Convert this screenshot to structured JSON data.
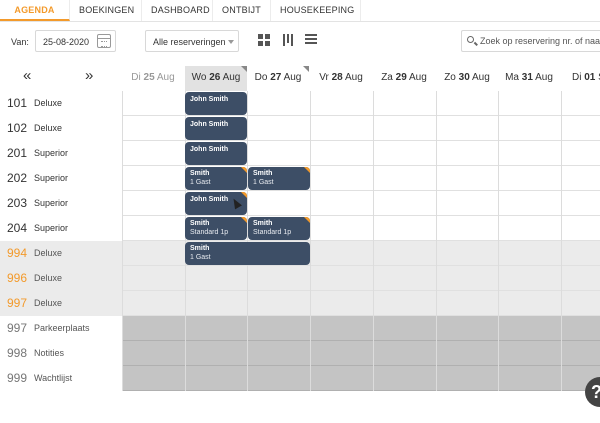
{
  "tabs": [
    {
      "label": "AGENDA",
      "active": true
    },
    {
      "label": "BOEKINGEN",
      "active": false
    },
    {
      "label": "DASHBOARD",
      "active": false
    },
    {
      "label": "ONTBIJT",
      "active": false
    },
    {
      "label": "HOUSEKEEPING",
      "active": false
    }
  ],
  "toolbar": {
    "van_label": "Van:",
    "date_value": "25-08-2020",
    "filter_value": "Alle reserveringen",
    "search_placeholder": "Zoek op reservering nr. of naam"
  },
  "nav": {
    "prev": "«",
    "next": "»"
  },
  "days": [
    {
      "dow": "Di",
      "day": "25",
      "month": "Aug",
      "state": "past"
    },
    {
      "dow": "Wo",
      "day": "26",
      "month": "Aug",
      "state": "today"
    },
    {
      "dow": "Do",
      "day": "27",
      "month": "Aug",
      "state": "normal"
    },
    {
      "dow": "Vr",
      "day": "28",
      "month": "Aug",
      "state": "normal"
    },
    {
      "dow": "Za",
      "day": "29",
      "month": "Aug",
      "state": "weekend"
    },
    {
      "dow": "Zo",
      "day": "30",
      "month": "Aug",
      "state": "weekend"
    },
    {
      "dow": "Ma",
      "day": "31",
      "month": "Aug",
      "state": "normal"
    },
    {
      "dow": "Di",
      "day": "01",
      "month": "S",
      "state": "normal"
    }
  ],
  "rooms": [
    {
      "number": "101",
      "type": "Deluxe",
      "kind": "room"
    },
    {
      "number": "102",
      "type": "Deluxe",
      "kind": "room"
    },
    {
      "number": "201",
      "type": "Superior",
      "kind": "room"
    },
    {
      "number": "202",
      "type": "Superior",
      "kind": "room"
    },
    {
      "number": "203",
      "type": "Superior",
      "kind": "room"
    },
    {
      "number": "204",
      "type": "Superior",
      "kind": "room"
    },
    {
      "number": "994",
      "type": "Deluxe",
      "kind": "virtual"
    },
    {
      "number": "996",
      "type": "Deluxe",
      "kind": "virtual"
    },
    {
      "number": "997",
      "type": "Deluxe",
      "kind": "virtual"
    },
    {
      "number": "997",
      "type": "Parkeerplaats",
      "kind": "extra"
    },
    {
      "number": "998",
      "type": "Notities",
      "kind": "extra"
    },
    {
      "number": "999",
      "type": "Wachtlijst",
      "kind": "extra"
    }
  ],
  "bookings": [
    {
      "name": "John Smith",
      "sub": "",
      "flag": false
    },
    {
      "name": "John Smith",
      "sub": "",
      "flag": false
    },
    {
      "name": "John Smith",
      "sub": "",
      "flag": false
    },
    {
      "name": "Smith",
      "sub": "1 Gast",
      "flag": true
    },
    {
      "name": "Smith",
      "sub": "1 Gast",
      "flag": true
    },
    {
      "name": "John Smith",
      "sub": "",
      "flag": true
    },
    {
      "name": "Smith",
      "sub": "Standard 1p",
      "flag": true
    },
    {
      "name": "Smith",
      "sub": "Standard 1p",
      "flag": true
    },
    {
      "name": "Smith",
      "sub": "1 Gast",
      "flag": false
    }
  ],
  "help": {
    "label": "?"
  },
  "colors": {
    "accent": "#f39a2b",
    "booking": "#3d4e66",
    "today": "#e2e2e2"
  }
}
